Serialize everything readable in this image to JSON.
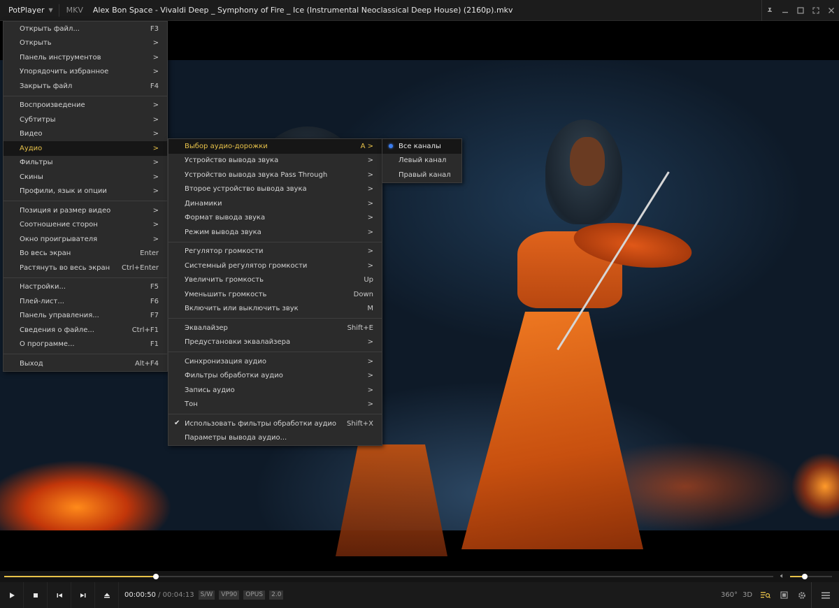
{
  "app": {
    "name": "PotPlayer",
    "format_badge": "MKV",
    "title": "Alex Bon Space - Vivaldi Deep _ Symphony of Fire _ Ice (Instrumental Neoclassical Deep House) (2160p).mkv"
  },
  "main_menu": [
    {
      "label": "Открыть файл...",
      "shortcut": "F3"
    },
    {
      "label": "Открыть",
      "shortcut": ">"
    },
    {
      "label": "Панель инструментов",
      "shortcut": ">"
    },
    {
      "label": "Упорядочить избранное",
      "shortcut": ">"
    },
    {
      "label": "Закрыть файл",
      "shortcut": "F4"
    },
    {
      "label": "Воспроизведение",
      "shortcut": ">"
    },
    {
      "label": "Субтитры",
      "shortcut": ">"
    },
    {
      "label": "Видео",
      "shortcut": ">"
    },
    {
      "label": "Аудио",
      "shortcut": ">"
    },
    {
      "label": "Фильтры",
      "shortcut": ">"
    },
    {
      "label": "Скины",
      "shortcut": ">"
    },
    {
      "label": "Профили, язык и опции",
      "shortcut": ">"
    },
    {
      "label": "Позиция и размер видео",
      "shortcut": ">"
    },
    {
      "label": "Соотношение сторон",
      "shortcut": ">"
    },
    {
      "label": "Окно проигрывателя",
      "shortcut": ">"
    },
    {
      "label": "Во весь экран",
      "shortcut": "Enter"
    },
    {
      "label": "Растянуть во весь экран",
      "shortcut": "Ctrl+Enter"
    },
    {
      "label": "Настройки...",
      "shortcut": "F5"
    },
    {
      "label": "Плей-лист...",
      "shortcut": "F6"
    },
    {
      "label": "Панель управления...",
      "shortcut": "F7"
    },
    {
      "label": "Сведения о файле...",
      "shortcut": "Ctrl+F1"
    },
    {
      "label": "О программе...",
      "shortcut": "F1"
    },
    {
      "label": "Выход",
      "shortcut": "Alt+F4"
    }
  ],
  "audio_menu": [
    {
      "label": "Выбор аудио-дорожки",
      "shortcut": "A >"
    },
    {
      "label": "Устройство вывода звука",
      "shortcut": ">"
    },
    {
      "label": "Устройство вывода звука Pass Through",
      "shortcut": ">"
    },
    {
      "label": "Второе устройство вывода звука",
      "shortcut": ">"
    },
    {
      "label": "Динамики",
      "shortcut": ">"
    },
    {
      "label": "Формат вывода звука",
      "shortcut": ">"
    },
    {
      "label": "Режим вывода звука",
      "shortcut": ">"
    },
    {
      "label": "Регулятор громкости",
      "shortcut": ">"
    },
    {
      "label": "Системный регулятор громкости",
      "shortcut": ">"
    },
    {
      "label": "Увеличить громкость",
      "shortcut": "Up"
    },
    {
      "label": "Уменьшить громкость",
      "shortcut": "Down"
    },
    {
      "label": "Включить или выключить звук",
      "shortcut": "M"
    },
    {
      "label": "Эквалайзер",
      "shortcut": "Shift+E"
    },
    {
      "label": "Предустановки эквалайзера",
      "shortcut": ">"
    },
    {
      "label": "Синхронизация аудио",
      "shortcut": ">"
    },
    {
      "label": "Фильтры обработки аудио",
      "shortcut": ">"
    },
    {
      "label": "Запись аудио",
      "shortcut": ">"
    },
    {
      "label": "Тон",
      "shortcut": ">"
    },
    {
      "label": "Использовать фильтры обработки аудио",
      "shortcut": "Shift+X"
    },
    {
      "label": "Параметры вывода аудио...",
      "shortcut": ""
    }
  ],
  "track_menu": [
    {
      "label": "Все каналы"
    },
    {
      "label": "Левый канал"
    },
    {
      "label": "Правый канал"
    }
  ],
  "player": {
    "current_time": "00:00:50",
    "separator": "/",
    "total_time": "00:04:13",
    "progress": 0.197,
    "volume": 0.35,
    "tags": [
      "S/W",
      "VP90",
      "OPUS",
      "2.0"
    ],
    "right_icons": [
      "360°",
      "3D"
    ]
  },
  "colors": {
    "accent": "#e8c24a",
    "menu_bg": "#2b2b2b",
    "selected_dot": "#3b7df0"
  }
}
